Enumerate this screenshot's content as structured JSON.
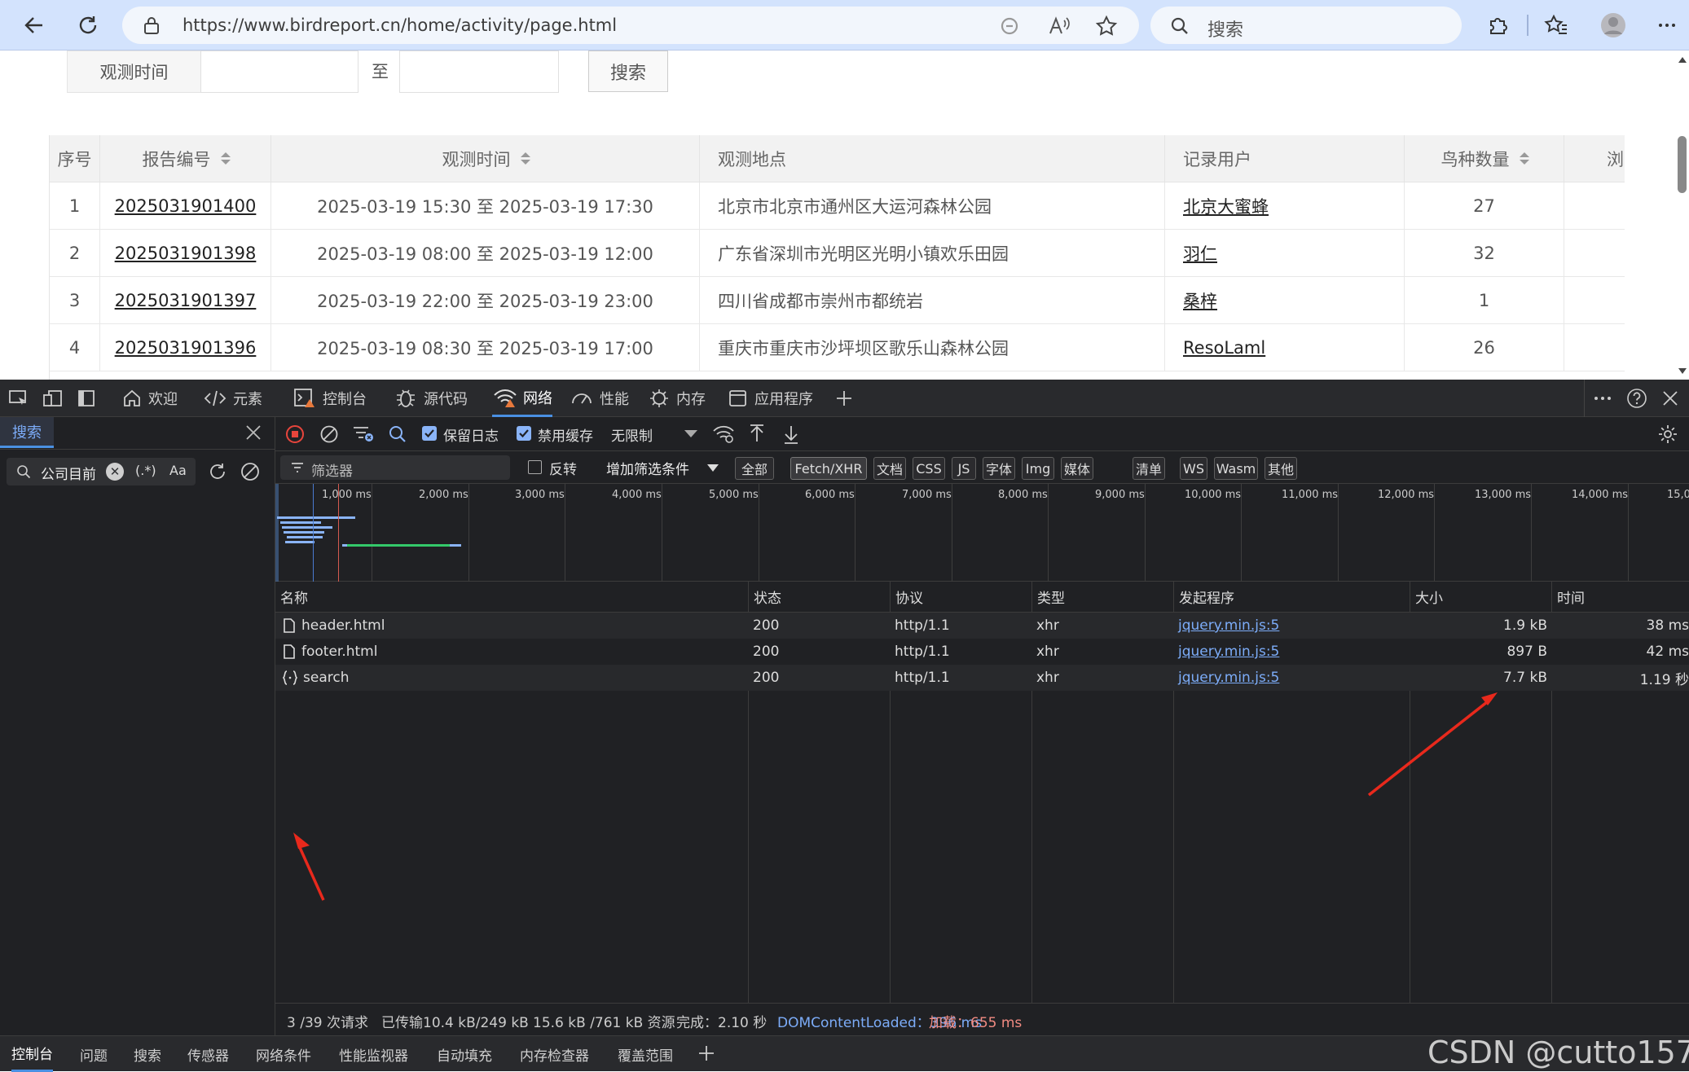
{
  "browser": {
    "url": "https://www.birdreport.cn/home/activity/page.html",
    "search_placeholder": "搜索"
  },
  "page": {
    "filter": {
      "obs_time_label": "观测时间",
      "to_label": "至",
      "start_value": "",
      "end_value": "",
      "search_button": "搜索"
    },
    "table": {
      "headers": [
        "序号",
        "报告编号",
        "观测时间",
        "观测地点",
        "记录用户",
        "鸟种数量",
        "浏"
      ],
      "rows": [
        {
          "no": "1",
          "report_id": "2025031901400",
          "time": "2025-03-19 15:30 至 2025-03-19 17:30",
          "location": "北京市北京市通州区大运河森林公园",
          "user": "北京大蜜蜂",
          "count": "27"
        },
        {
          "no": "2",
          "report_id": "2025031901398",
          "time": "2025-03-19 08:00 至 2025-03-19 12:00",
          "location": "广东省深圳市光明区光明小镇欢乐田园",
          "user": "羽仁",
          "count": "32"
        },
        {
          "no": "3",
          "report_id": "2025031901397",
          "time": "2025-03-19 22:00 至 2025-03-19 23:00",
          "location": "四川省成都市崇州市都统岩",
          "user": "桑梓",
          "count": "1"
        },
        {
          "no": "4",
          "report_id": "2025031901396",
          "time": "2025-03-19 08:30 至 2025-03-19 17:00",
          "location": "重庆市重庆市沙坪坝区歌乐山森林公园",
          "user": "ResoLaml",
          "count": "26"
        }
      ]
    }
  },
  "devtools": {
    "tabs": [
      "欢迎",
      "元素",
      "控制台",
      "源代码",
      "网络",
      "性能",
      "内存",
      "应用程序"
    ],
    "active_tab": "网络",
    "left_panel": {
      "tab": "搜索",
      "search_value": "公司目前",
      "regex_label": "(.*)",
      "case_label": "Aa"
    },
    "toolbar": {
      "preserve_log": "保留日志",
      "disable_cache": "禁用缓存",
      "throttle": "无限制"
    },
    "filter": {
      "placeholder": "筛选器",
      "invert": "反转",
      "more_filters": "增加筛选条件",
      "chips": [
        "全部",
        "Fetch/XHR",
        "文档",
        "CSS",
        "JS",
        "字体",
        "Img",
        "媒体",
        "清单",
        "WS",
        "Wasm",
        "其他"
      ]
    },
    "timeline_ticks": [
      "1,000 ms",
      "2,000 ms",
      "3,000 ms",
      "4,000 ms",
      "5,000 ms",
      "6,000 ms",
      "7,000 ms",
      "8,000 ms",
      "9,000 ms",
      "10,000 ms",
      "11,000 ms",
      "12,000 ms",
      "13,000 ms",
      "14,000 ms",
      "15,0"
    ],
    "columns": [
      "名称",
      "状态",
      "协议",
      "类型",
      "发起程序",
      "大小",
      "时间"
    ],
    "requests": [
      {
        "name": "header.html",
        "status": "200",
        "protocol": "http/1.1",
        "type": "xhr",
        "initiator": "jquery.min.js:5",
        "size": "1.9 kB",
        "time": "38 ms"
      },
      {
        "name": "footer.html",
        "status": "200",
        "protocol": "http/1.1",
        "type": "xhr",
        "initiator": "jquery.min.js:5",
        "size": "897 B",
        "time": "42 ms"
      },
      {
        "name": "search",
        "status": "200",
        "protocol": "http/1.1",
        "type": "xhr",
        "initiator": "jquery.min.js:5",
        "size": "7.7 kB",
        "time": "1.19 秒"
      }
    ],
    "status_bar": {
      "requests": "3 /39 次请求",
      "transferred": "已传输10.4 kB/249 kB",
      "resources": "15.6 kB /761 kB 资源",
      "finish": "完成：2.10 秒",
      "dcl": "DOMContentLoaded：396 ms",
      "load": "加载：655 ms"
    },
    "drawer_tabs": [
      "控制台",
      "问题",
      "搜索",
      "传感器",
      "网络条件",
      "性能监视器",
      "自动填充",
      "内存检查器",
      "覆盖范围"
    ],
    "watermark": "CSDN @cutto157"
  },
  "colors": {
    "toolbar_bg": "#d3e3fd",
    "devtools_bg": "#202124",
    "link_blue": "#7cacf8",
    "dcl_blue": "#7cacf8",
    "load_red": "#f28b82",
    "record_red": "#e8453c",
    "annotation_red": "#e8291c"
  }
}
